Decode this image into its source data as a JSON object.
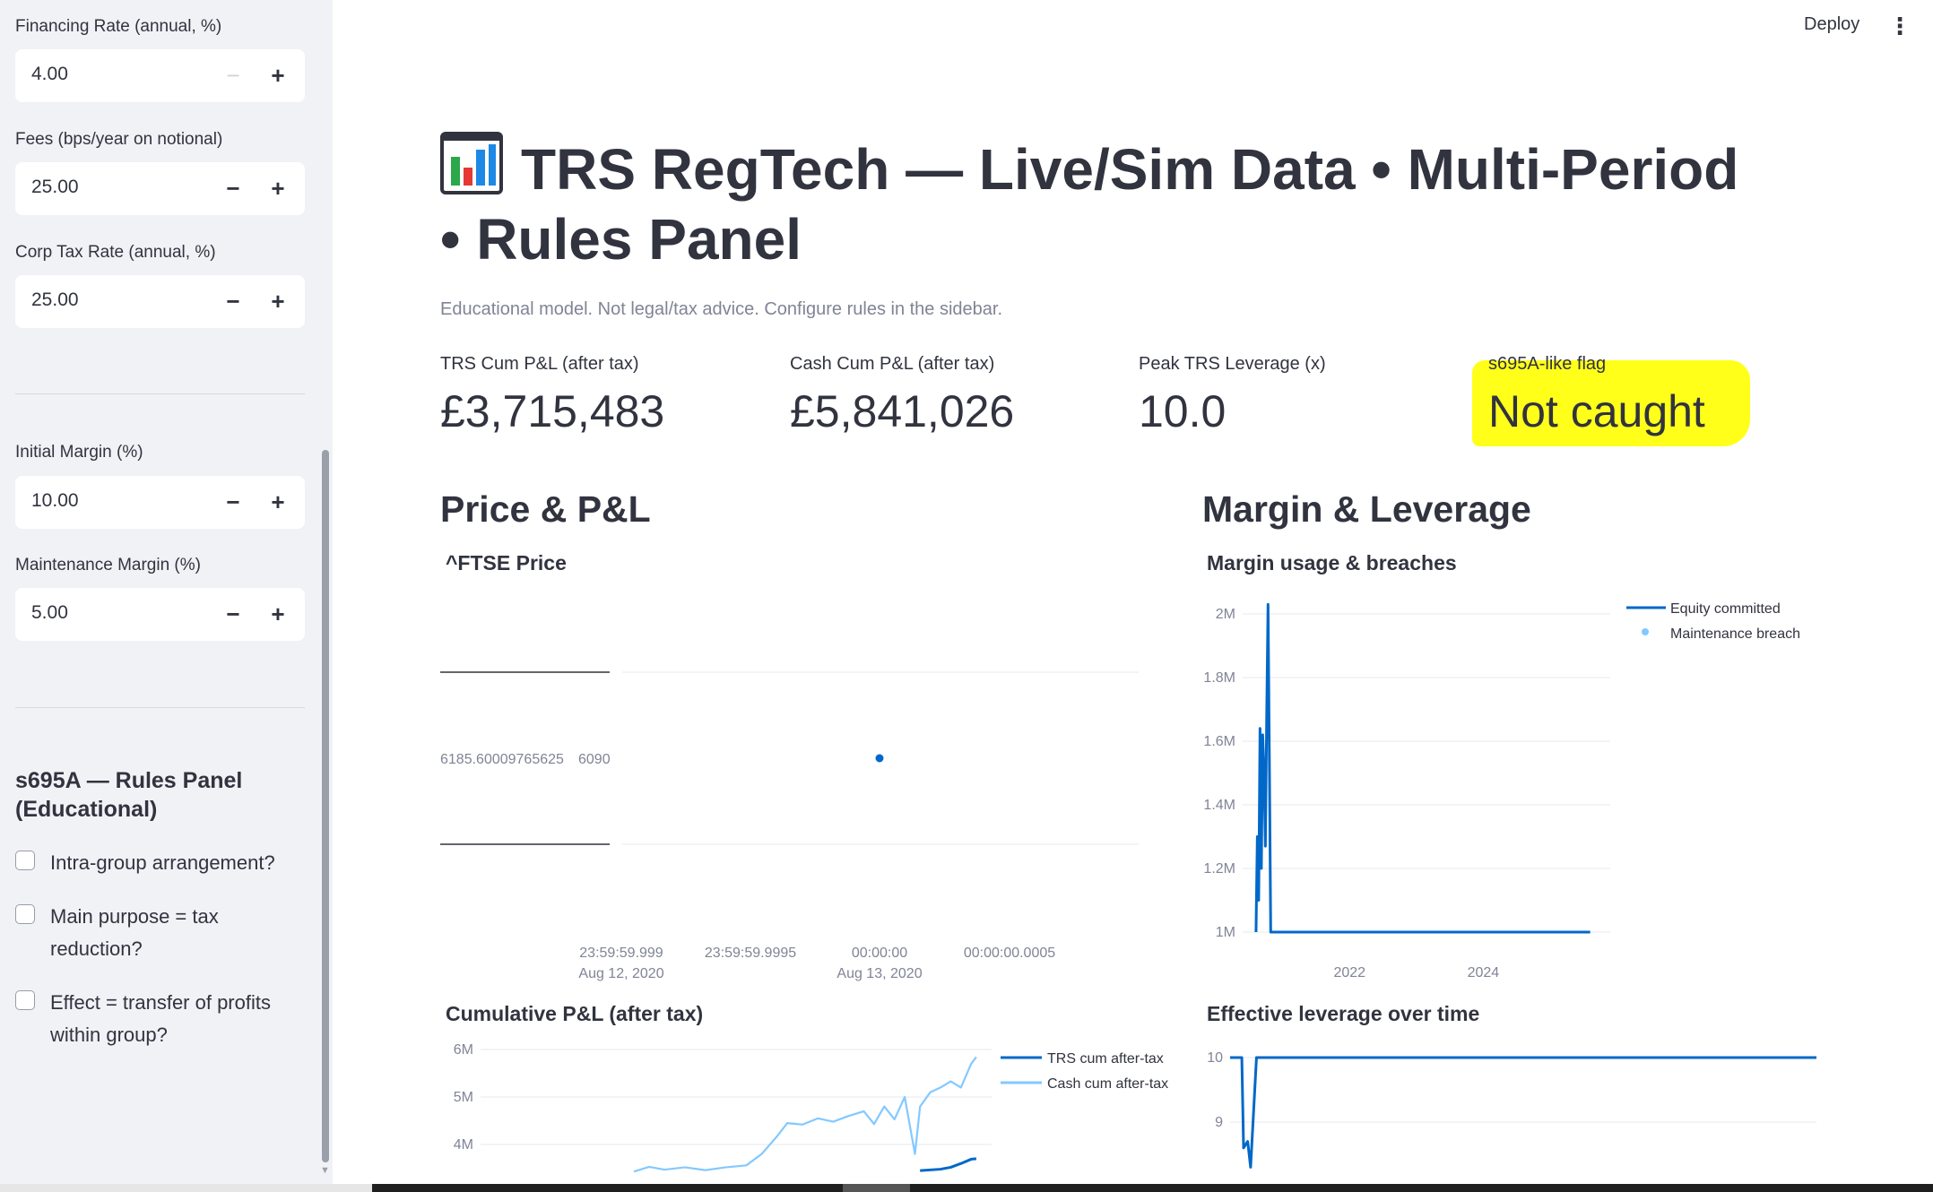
{
  "sidebar": {
    "inputs": [
      {
        "label": "Financing Rate (annual, %)",
        "value": "4.00"
      },
      {
        "label": "Fees (bps/year on notional)",
        "value": "25.00"
      },
      {
        "label": "Corp Tax Rate (annual, %)",
        "value": "25.00"
      },
      {
        "label": "Initial Margin (%)",
        "value": "10.00"
      },
      {
        "label": "Maintenance Margin (%)",
        "value": "5.00"
      }
    ],
    "minus_glyph": "−",
    "plus_glyph": "+",
    "rules_heading": "s695A — Rules Panel (Educational)",
    "checkboxes": [
      {
        "label": "Intra-group arrangement?",
        "checked": false
      },
      {
        "label": "Main purpose = tax reduction?",
        "checked": false
      },
      {
        "label": "Effect = transfer of profits within group?",
        "checked": false
      }
    ]
  },
  "header": {
    "deploy_label": "Deploy",
    "menu_icon": "more-vertical-icon",
    "menu_glyph": "⋮"
  },
  "main": {
    "title_icon": "bar-chart-icon",
    "title": "TRS RegTech — Live/Sim Data • Multi-Period • Rules Panel",
    "caption": "Educational model. Not legal/tax advice. Configure rules in the sidebar.",
    "metrics": [
      {
        "label": "TRS Cum P&L (after tax)",
        "value": "£3,715,483"
      },
      {
        "label": "Cash Cum P&L (after tax)",
        "value": "£5,841,026"
      },
      {
        "label": "Peak TRS Leverage (x)",
        "value": "10.0"
      },
      {
        "label": "s695A-like flag",
        "value": "Not caught"
      }
    ],
    "sections": {
      "left": "Price & P&L",
      "right": "Margin & Leverage"
    }
  },
  "chart_data": [
    {
      "type": "scatter",
      "title": "^FTSE Price",
      "y_tick_labels": [
        "6185.60009765625",
        "6090"
      ],
      "x_tick_labels": [
        {
          "time": "23:59:59.999",
          "date": "Aug 12, 2020"
        },
        {
          "time": "23:59:59.9995",
          "date": ""
        },
        {
          "time": "00:00:00",
          "date": "Aug 13, 2020"
        },
        {
          "time": "00:00:00.0005",
          "date": ""
        }
      ],
      "points": [
        {
          "x": "2020-08-13 00:00:00",
          "y": 6185.60009765625
        }
      ],
      "color": "#0068c9"
    },
    {
      "type": "line",
      "title": "Margin usage & breaches",
      "y_ticks": [
        "1M",
        "1.2M",
        "1.4M",
        "1.6M",
        "1.8M",
        "2M"
      ],
      "ylim": [
        1000000,
        2000000
      ],
      "x_ticks": [
        "2022",
        "2024"
      ],
      "xlim": [
        2020.4,
        2025.9
      ],
      "legend": [
        "Equity committed",
        "Maintenance breach"
      ],
      "legend_position": "top-right",
      "series": [
        {
          "name": "Equity committed",
          "color": "#0068c9",
          "points": [
            [
              2020.6,
              1000000
            ],
            [
              2020.62,
              1300000
            ],
            [
              2020.64,
              1100000
            ],
            [
              2020.66,
              1640000
            ],
            [
              2020.68,
              1200000
            ],
            [
              2020.7,
              1620000
            ],
            [
              2020.72,
              1500000
            ],
            [
              2020.74,
              1270000
            ],
            [
              2020.76,
              1680000
            ],
            [
              2020.78,
              2030000
            ],
            [
              2020.8,
              1540000
            ],
            [
              2020.82,
              1000000
            ],
            [
              2021.2,
              1000000
            ],
            [
              2022.5,
              1000000
            ],
            [
              2024.0,
              1000000
            ],
            [
              2025.6,
              1000000
            ]
          ]
        },
        {
          "name": "Maintenance breach",
          "color": "#83c9ff",
          "points": []
        }
      ]
    },
    {
      "type": "line",
      "title": "Cumulative P&L (after tax)",
      "y_ticks": [
        "4M",
        "5M",
        "6M"
      ],
      "legend": [
        "TRS cum after-tax",
        "Cash cum after-tax"
      ],
      "legend_position": "top-right",
      "series": [
        {
          "name": "TRS cum after-tax",
          "color": "#0068c9",
          "points": [
            [
              0.86,
              3450000
            ],
            [
              0.9,
              3480000
            ],
            [
              0.92,
              3520000
            ],
            [
              0.94,
              3600000
            ],
            [
              0.96,
              3690000
            ],
            [
              0.97,
              3700000
            ]
          ]
        },
        {
          "name": "Cash cum after-tax",
          "color": "#83c9ff",
          "points": [
            [
              0.3,
              3430000
            ],
            [
              0.33,
              3530000
            ],
            [
              0.36,
              3470000
            ],
            [
              0.4,
              3520000
            ],
            [
              0.44,
              3460000
            ],
            [
              0.48,
              3520000
            ],
            [
              0.52,
              3560000
            ],
            [
              0.55,
              3800000
            ],
            [
              0.58,
              4170000
            ],
            [
              0.6,
              4450000
            ],
            [
              0.63,
              4420000
            ],
            [
              0.66,
              4550000
            ],
            [
              0.69,
              4480000
            ],
            [
              0.72,
              4600000
            ],
            [
              0.75,
              4700000
            ],
            [
              0.77,
              4430000
            ],
            [
              0.79,
              4800000
            ],
            [
              0.81,
              4530000
            ],
            [
              0.83,
              5000000
            ],
            [
              0.84,
              4400000
            ],
            [
              0.85,
              3800000
            ],
            [
              0.86,
              4800000
            ],
            [
              0.88,
              5100000
            ],
            [
              0.9,
              5200000
            ],
            [
              0.92,
              5330000
            ],
            [
              0.94,
              5200000
            ],
            [
              0.96,
              5700000
            ],
            [
              0.97,
              5840000
            ]
          ]
        }
      ]
    },
    {
      "type": "line",
      "title": "Effective leverage over time",
      "y_ticks": [
        "9",
        "10"
      ],
      "series": [
        {
          "name": "",
          "color": "#0068c9",
          "points": [
            [
              0.0,
              10
            ],
            [
              0.02,
              10
            ],
            [
              0.023,
              8.6
            ],
            [
              0.03,
              8.7
            ],
            [
              0.035,
              8.3
            ],
            [
              0.045,
              10
            ],
            [
              0.1,
              10
            ],
            [
              1.0,
              10
            ]
          ]
        }
      ]
    }
  ]
}
